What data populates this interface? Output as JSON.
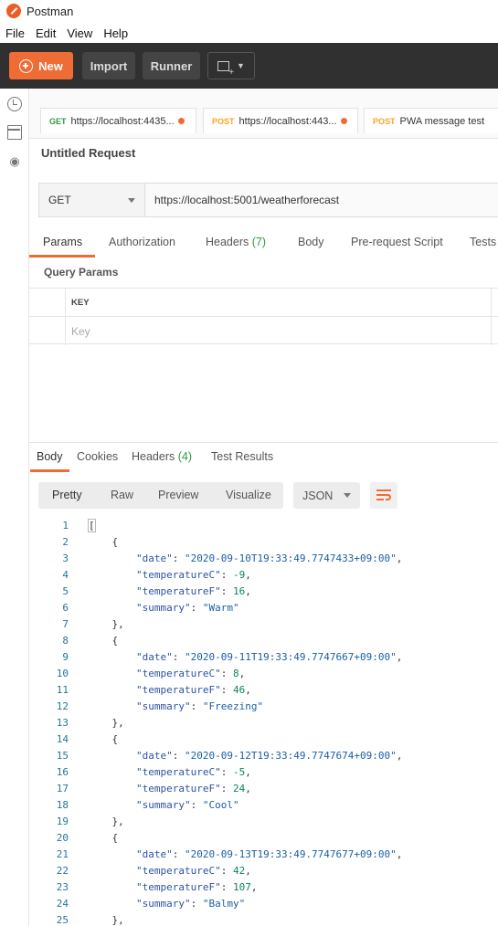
{
  "app": {
    "title": "Postman",
    "menu": [
      "File",
      "Edit",
      "View",
      "Help"
    ]
  },
  "toolbar": {
    "new_label": "New",
    "import_label": "Import",
    "runner_label": "Runner"
  },
  "tabs": [
    {
      "method": "GET",
      "label": "https://localhost:4435...",
      "unsaved": true
    },
    {
      "method": "POST",
      "label": "https://localhost:443...",
      "unsaved": true
    },
    {
      "method": "POST",
      "label": "PWA message test",
      "unsaved": false
    }
  ],
  "request": {
    "name": "Untitled Request",
    "method": "GET",
    "url": "https://localhost:5001/weatherforecast",
    "tabs": [
      "Params",
      "Authorization",
      "Headers",
      "Body",
      "Pre-request Script",
      "Tests"
    ],
    "headers_count": "(7)",
    "query_params_title": "Query Params",
    "key_header": "KEY",
    "key_placeholder": "Key"
  },
  "response": {
    "tabs": [
      "Body",
      "Cookies",
      "Headers",
      "Test Results"
    ],
    "headers_count": "(4)",
    "view_modes": [
      "Pretty",
      "Raw",
      "Preview",
      "Visualize"
    ],
    "format": "JSON",
    "lines": [
      {
        "n": "1",
        "text": "["
      },
      {
        "n": "2",
        "text": "    {"
      },
      {
        "n": "3",
        "key": "\"date\"",
        "val": "\"2020-09-10T19:33:49.7747433+09:00\"",
        "type": "s",
        "end": ","
      },
      {
        "n": "4",
        "key": "\"temperatureC\"",
        "val": "-9",
        "type": "n",
        "end": ","
      },
      {
        "n": "5",
        "key": "\"temperatureF\"",
        "val": "16",
        "type": "n",
        "end": ","
      },
      {
        "n": "6",
        "key": "\"summary\"",
        "val": "\"Warm\"",
        "type": "s",
        "end": ""
      },
      {
        "n": "7",
        "text": "    },"
      },
      {
        "n": "8",
        "text": "    {"
      },
      {
        "n": "9",
        "key": "\"date\"",
        "val": "\"2020-09-11T19:33:49.7747667+09:00\"",
        "type": "s",
        "end": ","
      },
      {
        "n": "10",
        "key": "\"temperatureC\"",
        "val": "8",
        "type": "n",
        "end": ","
      },
      {
        "n": "11",
        "key": "\"temperatureF\"",
        "val": "46",
        "type": "n",
        "end": ","
      },
      {
        "n": "12",
        "key": "\"summary\"",
        "val": "\"Freezing\"",
        "type": "s",
        "end": ""
      },
      {
        "n": "13",
        "text": "    },"
      },
      {
        "n": "14",
        "text": "    {"
      },
      {
        "n": "15",
        "key": "\"date\"",
        "val": "\"2020-09-12T19:33:49.7747674+09:00\"",
        "type": "s",
        "end": ","
      },
      {
        "n": "16",
        "key": "\"temperatureC\"",
        "val": "-5",
        "type": "n",
        "end": ","
      },
      {
        "n": "17",
        "key": "\"temperatureF\"",
        "val": "24",
        "type": "n",
        "end": ","
      },
      {
        "n": "18",
        "key": "\"summary\"",
        "val": "\"Cool\"",
        "type": "s",
        "end": ""
      },
      {
        "n": "19",
        "text": "    },"
      },
      {
        "n": "20",
        "text": "    {"
      },
      {
        "n": "21",
        "key": "\"date\"",
        "val": "\"2020-09-13T19:33:49.7747677+09:00\"",
        "type": "s",
        "end": ","
      },
      {
        "n": "22",
        "key": "\"temperatureC\"",
        "val": "42",
        "type": "n",
        "end": ","
      },
      {
        "n": "23",
        "key": "\"temperatureF\"",
        "val": "107",
        "type": "n",
        "end": ","
      },
      {
        "n": "24",
        "key": "\"summary\"",
        "val": "\"Balmy\"",
        "type": "s",
        "end": ""
      },
      {
        "n": "25",
        "text": "    },"
      }
    ]
  },
  "colors": {
    "accent": "#ef6c35",
    "get": "#2f9a46",
    "post": "#f5a623",
    "toolbar_bg": "#303030"
  }
}
